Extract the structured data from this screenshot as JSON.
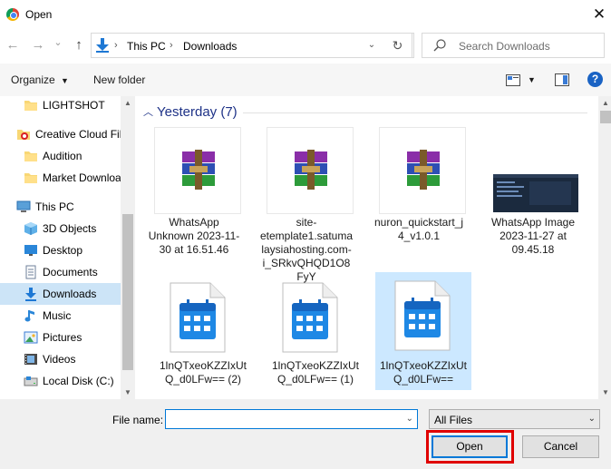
{
  "window": {
    "title": "Open",
    "close_glyph": "✕"
  },
  "nav": {
    "back_glyph": "←",
    "forward_glyph": "→",
    "recent_glyph": "⌄",
    "up_glyph": "↑",
    "breadcrumbs": [
      "This PC",
      "Downloads"
    ],
    "crumb_sep": "›",
    "dropdown_glyph": "⌄",
    "refresh_glyph": "↻",
    "search_placeholder": "Search Downloads"
  },
  "toolbar": {
    "organize_label": "Organize",
    "new_folder_label": "New folder",
    "help_glyph": "?"
  },
  "sidebar": {
    "items": [
      {
        "label": "LIGHTSHOT",
        "icon": "folder-icon"
      },
      {
        "label": "Creative Cloud Files",
        "icon": "creative-cloud-icon"
      },
      {
        "label": "Audition",
        "icon": "folder-icon"
      },
      {
        "label": "Market Downloads",
        "icon": "folder-icon"
      },
      {
        "label": "This PC",
        "icon": "computer-icon"
      },
      {
        "label": "3D Objects",
        "icon": "cube-icon"
      },
      {
        "label": "Desktop",
        "icon": "desktop-icon"
      },
      {
        "label": "Documents",
        "icon": "documents-icon"
      },
      {
        "label": "Downloads",
        "icon": "download-icon",
        "selected": true
      },
      {
        "label": "Music",
        "icon": "music-icon"
      },
      {
        "label": "Pictures",
        "icon": "pictures-icon"
      },
      {
        "label": "Videos",
        "icon": "videos-icon"
      },
      {
        "label": "Local Disk (C:)",
        "icon": "disk-icon"
      }
    ]
  },
  "content": {
    "group_label": "Yesterday (7)",
    "files": [
      {
        "name": "WhatsApp Unknown 2023-11-30 at 16.51.46",
        "type": "archive"
      },
      {
        "name": "site-etemplate1.satumalaysiahosting.com-i_SRkvQHQD1O8FyY",
        "type": "archive"
      },
      {
        "name": "nuron_quickstart_j4_v1.0.1",
        "type": "archive"
      },
      {
        "name": "WhatsApp Image 2023-11-27 at 09.45.18",
        "type": "image"
      },
      {
        "name": "1lnQTxeoKZZIxUtQ_d0LFw== (2)",
        "type": "calendar"
      },
      {
        "name": "1lnQTxeoKZZIxUtQ_d0LFw== (1)",
        "type": "calendar"
      },
      {
        "name": "1lnQTxeoKZZIxUtQ_d0LFw==",
        "type": "calendar",
        "selected": true
      }
    ]
  },
  "footer": {
    "filename_label": "File name:",
    "filename_value": "",
    "filetype_value": "All Files",
    "open_label": "Open",
    "cancel_label": "Cancel"
  },
  "colors": {
    "accent": "#0078d7",
    "selection": "#cce4f7",
    "highlight": "#e00000",
    "group_text": "#1e3287"
  }
}
